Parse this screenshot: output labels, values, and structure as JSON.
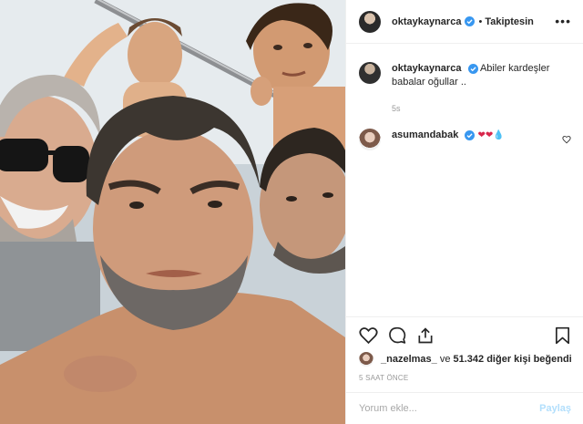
{
  "post": {
    "author": {
      "username": "oktaykaynarca",
      "follow_state": "Takiptesin",
      "separator": "•"
    },
    "caption": {
      "username": "oktaykaynarca",
      "text": "Abiler kardeşler babalar oğullar ..",
      "age": "5s"
    },
    "comments": [
      {
        "username": "asumandabak"
      }
    ],
    "likes": {
      "first_liker": "_nazelmas_",
      "conjunction": "ve",
      "count_text": "51.342 diğer kişi beğendi"
    },
    "timestamp": "5 SAAT ÖNCE",
    "comment_box": {
      "placeholder": "Yorum ekle...",
      "post_label": "Paylaş"
    },
    "icons": {
      "verified": "verified-badge-icon",
      "like": "heart-icon",
      "comment": "comment-bubble-icon",
      "share": "share-icon",
      "save": "bookmark-icon",
      "more": "more-options-icon"
    },
    "colors": {
      "verified_blue": "#3897f0",
      "post_button_disabled": "#b2dffc",
      "meta_gray": "#999999"
    }
  }
}
